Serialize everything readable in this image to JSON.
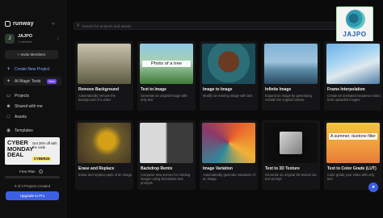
{
  "app": {
    "brand": "runway"
  },
  "workspace": {
    "avatar_letter": "J",
    "name": "JAJPO",
    "members": "1 member"
  },
  "sidebar": {
    "invite_label": "+ Invite Members",
    "items": [
      {
        "label": "Create New Project",
        "icon": "plus-icon"
      },
      {
        "label": "AI Magic Tools",
        "icon": "sparkle-icon",
        "badge": "New"
      },
      {
        "label": "Projects",
        "icon": "folder-icon"
      },
      {
        "label": "Shared with me",
        "icon": "people-icon"
      },
      {
        "label": "Assets",
        "icon": "box-icon"
      },
      {
        "label": "Templates",
        "icon": "template-icon"
      }
    ],
    "promo": {
      "title": "CYBER MONDAY DEAL",
      "offer": "Get 25% off with the code",
      "code": "CYBER25"
    },
    "plan": {
      "label": "Free Plan",
      "info": "i",
      "progress_fraction": 0,
      "projects_created": "0 of 3 Projects Created"
    },
    "upgrade_label": "Upgrade to Pro"
  },
  "search": {
    "placeholder": "Search for projects and assets"
  },
  "logo": {
    "text": "JAJPO"
  },
  "tools": [
    {
      "title": "Remove Background",
      "desc": "Automatically remove the background of a video"
    },
    {
      "title": "Text to Image",
      "desc": "Generate an original image with only text",
      "thumb_caption": "Photo of a tree"
    },
    {
      "title": "Image to Image",
      "desc": "Modify an existing image with text"
    },
    {
      "title": "Infinite Image",
      "desc": "Expand an image by generating outside the original canvas"
    },
    {
      "title": "Frame Interpolation",
      "desc": "Create an animated sequence video from uploaded images"
    },
    {
      "title": "Erase and Replace",
      "desc": "Erase and replace parts of an image"
    },
    {
      "title": "Backdrop Remix",
      "desc": "Compose new scenes for existing images using descriptive text prompts"
    },
    {
      "title": "Image Variation",
      "desc": "Automatically generate variations of an image"
    },
    {
      "title": "Text to 3D Texture",
      "desc": "Generate an original 3D texture via text prompt"
    },
    {
      "title": "Text to Color Grade (LUT)",
      "desc": "Color grade your video with only text",
      "thumb_caption": "A summer, duotone filter"
    }
  ],
  "colors": {
    "accent": "#3d5fe3",
    "badge": "#6b45e6",
    "background": "#0b0b0c",
    "create_link": "#7fa5ff"
  }
}
